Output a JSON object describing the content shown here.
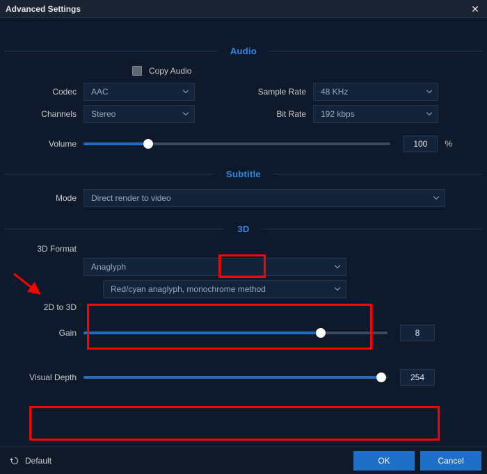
{
  "window": {
    "title": "Advanced Settings"
  },
  "audio": {
    "header": "Audio",
    "copy_label": "Copy Audio",
    "codec_label": "Codec",
    "codec_value": "AAC",
    "channels_label": "Channels",
    "channels_value": "Stereo",
    "samplerate_label": "Sample Rate",
    "samplerate_value": "48 KHz",
    "bitrate_label": "Bit Rate",
    "bitrate_value": "192 kbps",
    "volume_label": "Volume",
    "volume_value": "100",
    "volume_unit": "%",
    "volume_fill_pct": 21
  },
  "subtitle": {
    "header": "Subtitle",
    "mode_label": "Mode",
    "mode_value": "Direct render to video"
  },
  "three_d": {
    "header": "3D",
    "format_label": "3D Format",
    "format_value": "Anaglyph",
    "method_value": "Red/cyan anaglyph, monochrome method",
    "twod_label": "2D to 3D",
    "gain_label": "Gain",
    "gain_value": "8",
    "gain_fill_pct": 78,
    "visual_depth_label": "Visual Depth",
    "visual_depth_value": "254",
    "visual_depth_fill_pct": 98
  },
  "footer": {
    "default_label": "Default",
    "ok_label": "OK",
    "cancel_label": "Cancel"
  }
}
